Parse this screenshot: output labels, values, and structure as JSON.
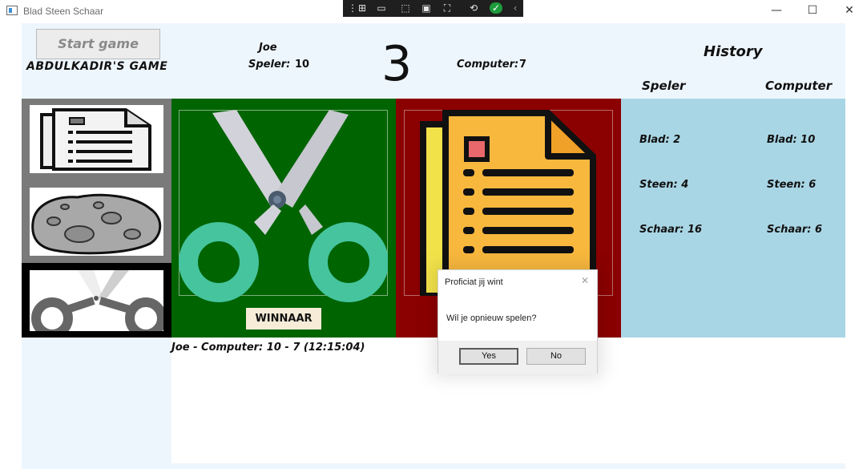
{
  "window": {
    "title": "Blad Steen Schaar",
    "controls": {
      "minimize": "—",
      "maximize": "☐",
      "close": "✕"
    }
  },
  "header": {
    "start_button": "Start game",
    "game_title": "ABDULKADIR'S GAME",
    "player_name": "Joe",
    "player_score_label": "Speler:",
    "player_score": "10",
    "round": "3",
    "computer_score_label": "Computer:",
    "computer_score": "7",
    "history_title": "History",
    "history_col_speler": "Speler",
    "history_col_computer": "Computer"
  },
  "choices": [
    {
      "name": "paper",
      "icon": "paper-icon"
    },
    {
      "name": "rock",
      "icon": "rock-icon"
    },
    {
      "name": "scissors",
      "icon": "scissors-icon",
      "selected": true
    }
  ],
  "picks": {
    "player_icon": "scissors-icon",
    "player_bg": "#006400",
    "winner_label": "WINNAAR",
    "computer_icon": "paper-icon",
    "computer_bg": "#8b0000"
  },
  "history": {
    "speler": {
      "blad": "Blad: 2",
      "steen": "Steen: 4",
      "schaar": "Schaar: 16"
    },
    "computer": {
      "blad": "Blad: 10",
      "steen": "Steen: 6",
      "schaar": "Schaar: 6"
    }
  },
  "log": [
    "Joe - Computer: 10 - 7 (12:15:04)"
  ],
  "dialog": {
    "title": "Proficiat jij wint",
    "message": "Wil je opnieuw spelen?",
    "yes": "Yes",
    "no": "No"
  }
}
